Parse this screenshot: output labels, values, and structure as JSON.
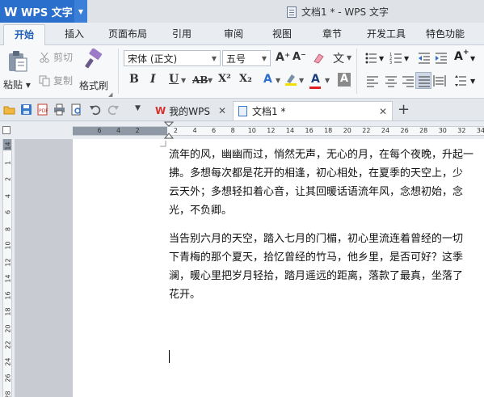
{
  "titlebar": {
    "app_name": "WPS 文字",
    "logo_text": "W",
    "doc_title": "文档1 * - WPS 文字"
  },
  "tabs": [
    {
      "label": "开始",
      "active": true
    },
    {
      "label": "插入"
    },
    {
      "label": "页面布局"
    },
    {
      "label": "引用"
    },
    {
      "label": "审阅"
    },
    {
      "label": "视图"
    },
    {
      "label": "章节"
    },
    {
      "label": "开发工具"
    },
    {
      "label": "特色功能"
    }
  ],
  "ribbon": {
    "paste_label": "粘贴",
    "cut_label": "剪切",
    "copy_label": "复制",
    "format_painter_label": "格式刷",
    "font_name": "宋体 (正文)",
    "font_size": "五号",
    "bold": "B",
    "italic": "I",
    "underline": "U",
    "strike": "AB",
    "superscript": "X²",
    "subscript": "X₂",
    "text_effect": "A",
    "font_color": "A",
    "char_shading": "A",
    "grow_font": "A⁺",
    "shrink_font": "A⁻",
    "phonetic": "文",
    "accent_color": "#2b6fcd",
    "font_color_bar": "#e02020",
    "highlight_color": "#f4e000"
  },
  "doc_tabs": [
    {
      "label": "我的WPS",
      "active": false
    },
    {
      "label": "文档1 *",
      "active": true
    }
  ],
  "ruler": {
    "h_numbers": [
      "6",
      "4",
      "2",
      "",
      "2",
      "4",
      "6",
      "8",
      "10",
      "12",
      "14",
      "16",
      "18",
      "20",
      "22",
      "24",
      "26",
      "28",
      "30",
      "32",
      "34"
    ],
    "v_numbers": [
      "14",
      "1",
      "2",
      "4",
      "6",
      "8",
      "10",
      "12",
      "14",
      "16",
      "18",
      "20",
      "22",
      "24",
      "26",
      "28"
    ]
  },
  "document": {
    "paragraph1": [
      "流年的风，幽幽而过，悄然无声，无心的月，在每个夜晚，升起一",
      "拂。多想每次都是花开的相逢，初心相处，在夏季的天空上，少",
      "云天外；多想轻扣着心音，让其回暖话语流年风，念想初始，念",
      "光，不负卿。"
    ],
    "paragraph2": [
      "当告别六月的天空，踏入七月的门楣，初心里流连着曾经的一切",
      "下青梅的那个夏天，拾忆曾经的竹马，他乡里，是否可好？这季",
      "澜，暖心里把岁月轻拾，踏月遥远的距离，落款了最真，坐落了",
      "花开。"
    ]
  }
}
